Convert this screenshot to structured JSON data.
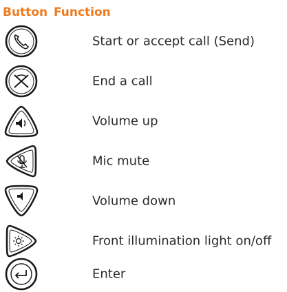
{
  "table": {
    "headers": {
      "button": "Button",
      "function": "Function"
    },
    "rows": [
      {
        "icon": "phone-send-icon",
        "function": "Start or accept call (Send)"
      },
      {
        "icon": "end-call-icon",
        "function": "End a call"
      },
      {
        "icon": "volume-up-icon",
        "function": "Volume up"
      },
      {
        "icon": "mic-mute-icon",
        "function": "Mic mute"
      },
      {
        "icon": "volume-down-icon",
        "function": "Volume down"
      },
      {
        "icon": "light-toggle-icon",
        "function": "Front illumination light on/off"
      },
      {
        "icon": "enter-icon",
        "function": "Enter"
      }
    ]
  },
  "colors": {
    "header": "#f07a1e",
    "text": "#2b2b2b",
    "icon_stroke": "#1a1a1a"
  }
}
